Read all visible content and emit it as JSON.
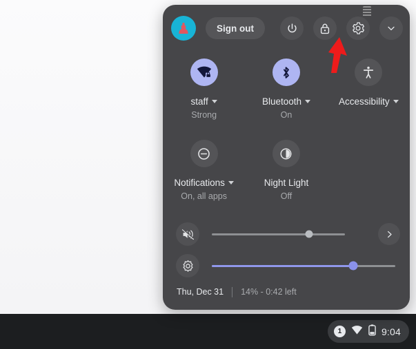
{
  "shelf": {
    "tray": {
      "notification_count": "1",
      "wifi_icon": "wifi-icon",
      "battery_icon": "battery-icon",
      "clock": "9:04"
    }
  },
  "quick_settings": {
    "avatar": {
      "icon": "user-avatar-icon"
    },
    "sign_out_label": "Sign out",
    "buttons": [
      {
        "name": "power-button",
        "icon": "power-icon"
      },
      {
        "name": "lock-button",
        "icon": "lock-icon"
      },
      {
        "name": "settings-button",
        "icon": "gear-icon"
      },
      {
        "name": "collapse-button",
        "icon": "chevron-down-icon"
      }
    ],
    "tiles": [
      {
        "name": "network",
        "icon": "wifi-locked-icon",
        "label": "staff",
        "sub": "Strong",
        "has_caret": true,
        "state": "on"
      },
      {
        "name": "bluetooth",
        "icon": "bluetooth-icon",
        "label": "Bluetooth",
        "sub": "On",
        "has_caret": true,
        "state": "on"
      },
      {
        "name": "accessibility",
        "icon": "accessibility-icon",
        "label": "Accessibility",
        "sub": "",
        "has_caret": true,
        "state": "off"
      },
      {
        "name": "notifications",
        "icon": "do-not-disturb-icon",
        "label": "Notifications",
        "sub": "On, all apps",
        "has_caret": true,
        "state": "off"
      },
      {
        "name": "night-light",
        "icon": "crescent-moon-icon",
        "label": "Night Light",
        "sub": "Off",
        "has_caret": false,
        "state": "off"
      }
    ],
    "sliders": {
      "volume": {
        "icon": "volume-muted-icon",
        "value_percent": 73,
        "muted": true,
        "expand_icon": "chevron-right-icon"
      },
      "brightness": {
        "icon": "brightness-sun-icon",
        "value_percent": 77
      }
    },
    "footer": {
      "date": "Thu, Dec 31",
      "battery_status": "14% - 0:42 left"
    }
  },
  "annotation": {
    "arrow_color": "#ee1b1b",
    "points_to": "settings-button"
  },
  "colors": {
    "panel_bg": "#464649",
    "accent": "#aeb5f2",
    "shelf_bg": "#1c1e20",
    "text_primary": "#e8eaed",
    "text_secondary": "#a9abae"
  }
}
